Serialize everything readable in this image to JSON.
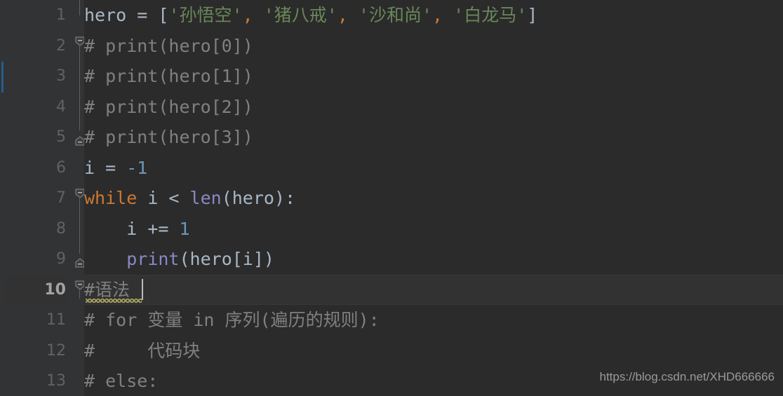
{
  "app": {
    "kind": "code-editor",
    "theme": "darcula",
    "editor_background": "#2b2b2b",
    "gutter_background": "#313335",
    "current_line_background": "#323232",
    "current_line_number": 10
  },
  "colors": {
    "default_text": "#a9b7c6",
    "string": "#6a8759",
    "comment": "#808080",
    "keyword": "#cc7832",
    "number": "#6897bb",
    "function": "#8888c6",
    "comma": "#cc7832",
    "line_number": "#606366",
    "current_line_number": "#a4a3a3",
    "vcs_change_marker": "#2a5b87",
    "spell_squiggle": "#a9a35e",
    "watermark": "#9a9a9a"
  },
  "gutter": {
    "line_numbers": [
      "1",
      "2",
      "3",
      "4",
      "5",
      "6",
      "7",
      "8",
      "9",
      "10",
      "11",
      "12",
      "13"
    ]
  },
  "fold_markers": [
    {
      "line": 2,
      "type": "fold-start",
      "icon": "fold-collapse-down-icon"
    },
    {
      "line": 5,
      "type": "fold-end",
      "icon": "fold-collapse-up-icon"
    },
    {
      "line": 7,
      "type": "fold-start",
      "icon": "fold-collapse-down-icon"
    },
    {
      "line": 9,
      "type": "fold-end",
      "icon": "fold-collapse-up-icon"
    },
    {
      "line": 10,
      "type": "fold-start",
      "icon": "fold-collapse-down-icon"
    }
  ],
  "code": {
    "language": "python",
    "lines": [
      {
        "number": 1,
        "text": "hero = ['孙悟空', '猪八戒', '沙和尚', '白龙马']",
        "tokens": [
          {
            "t": "hero",
            "c": "t-default"
          },
          {
            "t": " ",
            "c": "t-default"
          },
          {
            "t": "=",
            "c": "t-op"
          },
          {
            "t": " ",
            "c": "t-default"
          },
          {
            "t": "[",
            "c": "t-punct"
          },
          {
            "t": "'孙悟空'",
            "c": "t-string"
          },
          {
            "t": ",",
            "c": "t-comma"
          },
          {
            "t": " ",
            "c": "t-default"
          },
          {
            "t": "'猪八戒'",
            "c": "t-string"
          },
          {
            "t": ",",
            "c": "t-comma"
          },
          {
            "t": " ",
            "c": "t-default"
          },
          {
            "t": "'沙和尚'",
            "c": "t-string"
          },
          {
            "t": ",",
            "c": "t-comma"
          },
          {
            "t": " ",
            "c": "t-default"
          },
          {
            "t": "'白龙马'",
            "c": "t-string"
          },
          {
            "t": "]",
            "c": "t-punct"
          }
        ]
      },
      {
        "number": 2,
        "text": "# print(hero[0])",
        "tokens": [
          {
            "t": "# print(hero[0])",
            "c": "t-comment"
          }
        ]
      },
      {
        "number": 3,
        "text": "# print(hero[1])",
        "tokens": [
          {
            "t": "# print(hero[1])",
            "c": "t-comment"
          }
        ]
      },
      {
        "number": 4,
        "text": "# print(hero[2])",
        "tokens": [
          {
            "t": "# print(hero[2])",
            "c": "t-comment"
          }
        ]
      },
      {
        "number": 5,
        "text": "# print(hero[3])",
        "tokens": [
          {
            "t": "# print(hero[3])",
            "c": "t-comment"
          }
        ]
      },
      {
        "number": 6,
        "text": "i = -1",
        "tokens": [
          {
            "t": "i",
            "c": "t-default"
          },
          {
            "t": " ",
            "c": "t-default"
          },
          {
            "t": "=",
            "c": "t-op"
          },
          {
            "t": " ",
            "c": "t-default"
          },
          {
            "t": "-1",
            "c": "t-number"
          }
        ]
      },
      {
        "number": 7,
        "text": "while i < len(hero):",
        "tokens": [
          {
            "t": "while",
            "c": "t-keyword"
          },
          {
            "t": " i ",
            "c": "t-default"
          },
          {
            "t": "<",
            "c": "t-op"
          },
          {
            "t": " ",
            "c": "t-default"
          },
          {
            "t": "len",
            "c": "t-func"
          },
          {
            "t": "(hero):",
            "c": "t-default"
          }
        ]
      },
      {
        "number": 8,
        "text": "    i += 1",
        "tokens": [
          {
            "t": "    i ",
            "c": "t-default"
          },
          {
            "t": "+=",
            "c": "t-op"
          },
          {
            "t": " ",
            "c": "t-default"
          },
          {
            "t": "1",
            "c": "t-number"
          }
        ]
      },
      {
        "number": 9,
        "text": "    print(hero[i])",
        "tokens": [
          {
            "t": "    ",
            "c": "t-default"
          },
          {
            "t": "print",
            "c": "t-func"
          },
          {
            "t": "(hero[i])",
            "c": "t-default"
          }
        ]
      },
      {
        "number": 10,
        "text": "#语法",
        "tokens": [
          {
            "t": "#语法",
            "c": "t-comment"
          }
        ]
      },
      {
        "number": 11,
        "text": "# for 变量 in 序列(遍历的规则):",
        "tokens": [
          {
            "t": "# for 变量 in 序列(遍历的规则):",
            "c": "t-comment"
          }
        ]
      },
      {
        "number": 12,
        "text": "#     代码块",
        "tokens": [
          {
            "t": "#     代码块",
            "c": "t-comment"
          }
        ]
      },
      {
        "number": 13,
        "text": "# else:",
        "tokens": [
          {
            "t": "# else:",
            "c": "t-comment"
          }
        ]
      }
    ]
  },
  "spell_warning": {
    "line": 10,
    "text": "#语法"
  },
  "watermark": {
    "text": "https://blog.csdn.net/XHD666666"
  }
}
